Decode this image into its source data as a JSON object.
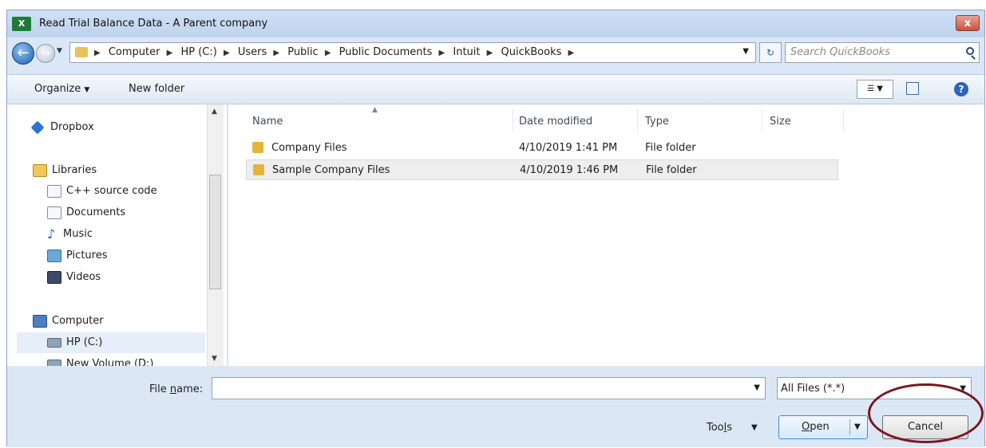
{
  "window": {
    "title": "Read Trial Balance Data  - A Parent company",
    "app_icon": "excel-icon",
    "close": "x"
  },
  "address": {
    "crumbs": [
      "Computer",
      "HP (C:)",
      "Users",
      "Public",
      "Public Documents",
      "Intuit",
      "QuickBooks"
    ],
    "search_placeholder": "Search QuickBooks",
    "refresh": "↻"
  },
  "toolbar": {
    "organize": "Organize",
    "new_folder": "New folder"
  },
  "nav": {
    "dropbox": "Dropbox",
    "libraries": "Libraries",
    "cpp": "C++ source code",
    "documents": "Documents",
    "music": "Music",
    "pictures": "Pictures",
    "videos": "Videos",
    "computer": "Computer",
    "hp": "HP (C:)",
    "newvol": "New Volume (D:)"
  },
  "columns": {
    "name": "Name",
    "date": "Date modified",
    "type": "Type",
    "size": "Size"
  },
  "files": [
    {
      "name": "Company Files",
      "date": "4/10/2019 1:41 PM",
      "type": "File folder"
    },
    {
      "name": "Sample Company Files",
      "date": "4/10/2019 1:46 PM",
      "type": "File folder"
    }
  ],
  "bottom": {
    "file_name_label_prefix": "File ",
    "file_name_label_accel": "n",
    "file_name_label_suffix": "ame:",
    "file_name_value": "",
    "filter": "All Files (*.*)",
    "tools_prefix": "Too",
    "tools_accel": "l",
    "tools_suffix": "s",
    "open_accel": "O",
    "open_rest": "pen",
    "cancel": "Cancel"
  },
  "accent_colors": {
    "highlight_circle": "#7a1620",
    "selection": "#e5eef9"
  }
}
